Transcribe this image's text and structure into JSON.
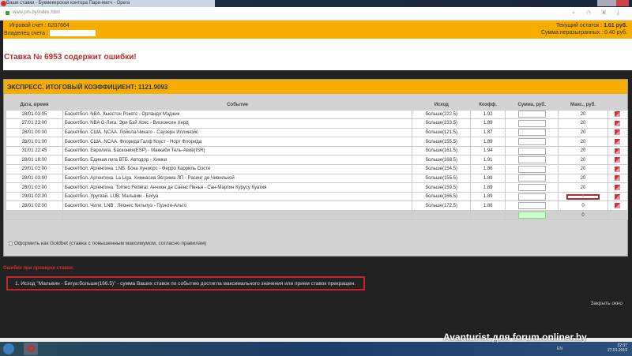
{
  "browser": {
    "title": "Ваши ставки - Букмекерская контора Пари-матч - Opera",
    "url": "www.pm.by/index.html"
  },
  "account": {
    "game_account_label": "Игровой счет :",
    "game_account": "6207664",
    "owner_label": "Владелец счета :",
    "balance_label": "Текущий остаток :",
    "balance": "1.61 руб.",
    "unplayed_label": "Сумма неразыгранных :",
    "unplayed": "0.40 руб."
  },
  "error_title": "Ставка № 6953 содержит ошибки!",
  "express": "ЭКСПРЕСС. ИТОГОВЫЙ КОЭФФИЦИЕНТ: 1121.9093",
  "table": {
    "headers": [
      "Дата, время",
      "Событие",
      "Исход",
      "Коэфф.",
      "Сумма, руб.",
      "Макс., руб."
    ],
    "rows": [
      [
        "28/01 03:05",
        "Баскетбол. NBA. Хьюстон Рокетс - Орландо Мэджик",
        "больше(222.5)",
        "1.92",
        "20"
      ],
      [
        "27/01 23:00",
        "Баскетбол. NBA G-Лига. Эри Бэй Хокс - Висконсин Херд",
        "больше(233.5)",
        "1.89",
        "20"
      ],
      [
        "28/01 00:00",
        "Баскетбол. США. NCAA. Лойола-Чикаго - Саузерн Иллинойс",
        "больше(121.5)",
        "1.87",
        "20"
      ],
      [
        "28/01 01:00",
        "Баскетбол. США. NCAA. Флорида Галф Коуст - Норт Флорида",
        "больше(155.5)",
        "1.89",
        "20"
      ],
      [
        "31/01 22:45",
        "Баскетбол. Евролига. Баскония(ESP) - Маккаби Тель-Авив(ISR)",
        "больше(161.5)",
        "1.94",
        "20"
      ],
      [
        "28/01 18:00",
        "Баскетбол. Единая лига ВТБ. Автодор - Химки",
        "больше(168.5)",
        "1.91",
        "20"
      ],
      [
        "29/01 03:00",
        "Баскетбол. Аргентина. LNB. Бока Хуниорс - Ферро Карриль Оэсте",
        "больше(154.5)",
        "1.86",
        "20"
      ],
      [
        "28/01 03:00",
        "Баскетбол. Аргентина. La Liga. Химнасия Эсгрима ЛП - Расинг де Чивилькой",
        "больше(155.5)",
        "1.89",
        "20"
      ],
      [
        "28/01 03:00",
        "Баскетбол. Аргентина. Torneo Federal. Анчион де Саенс Пенья - Сан-Мартин Курусу Куатия",
        "больше(159.5)",
        "1.89",
        "20"
      ],
      [
        "29/01 02:30",
        "Баскетбол. Уругвай. LUB. Мальвин - Бигуа",
        "больше(166.5)",
        "1.89",
        "0"
      ],
      [
        "28/01 02:00",
        "Баскетбол. Чили. LNB . Леонес Кильпуэ - Пуэнте-Альто",
        "больше(172.5)",
        "1.88",
        "0"
      ]
    ],
    "total_max": "0"
  },
  "goldbet_label": "Оформить как Goldbet (ставка с повышенным максимумом, согласно правилам)",
  "errors_label": "Ошибки при проверке ставки:",
  "error_item": "1. Исход \"Мальвин - Бигуа:больше(166.5)\" - сумма Ваших ставок по событию достигла максимального значения или прием ставок прекращен.",
  "close_label": "Закрыть окно",
  "taskbar": {
    "lang": "EN",
    "time": "22:37",
    "date": "27.01.2019"
  },
  "watermark": "Avanturist для forum.onliner.by"
}
